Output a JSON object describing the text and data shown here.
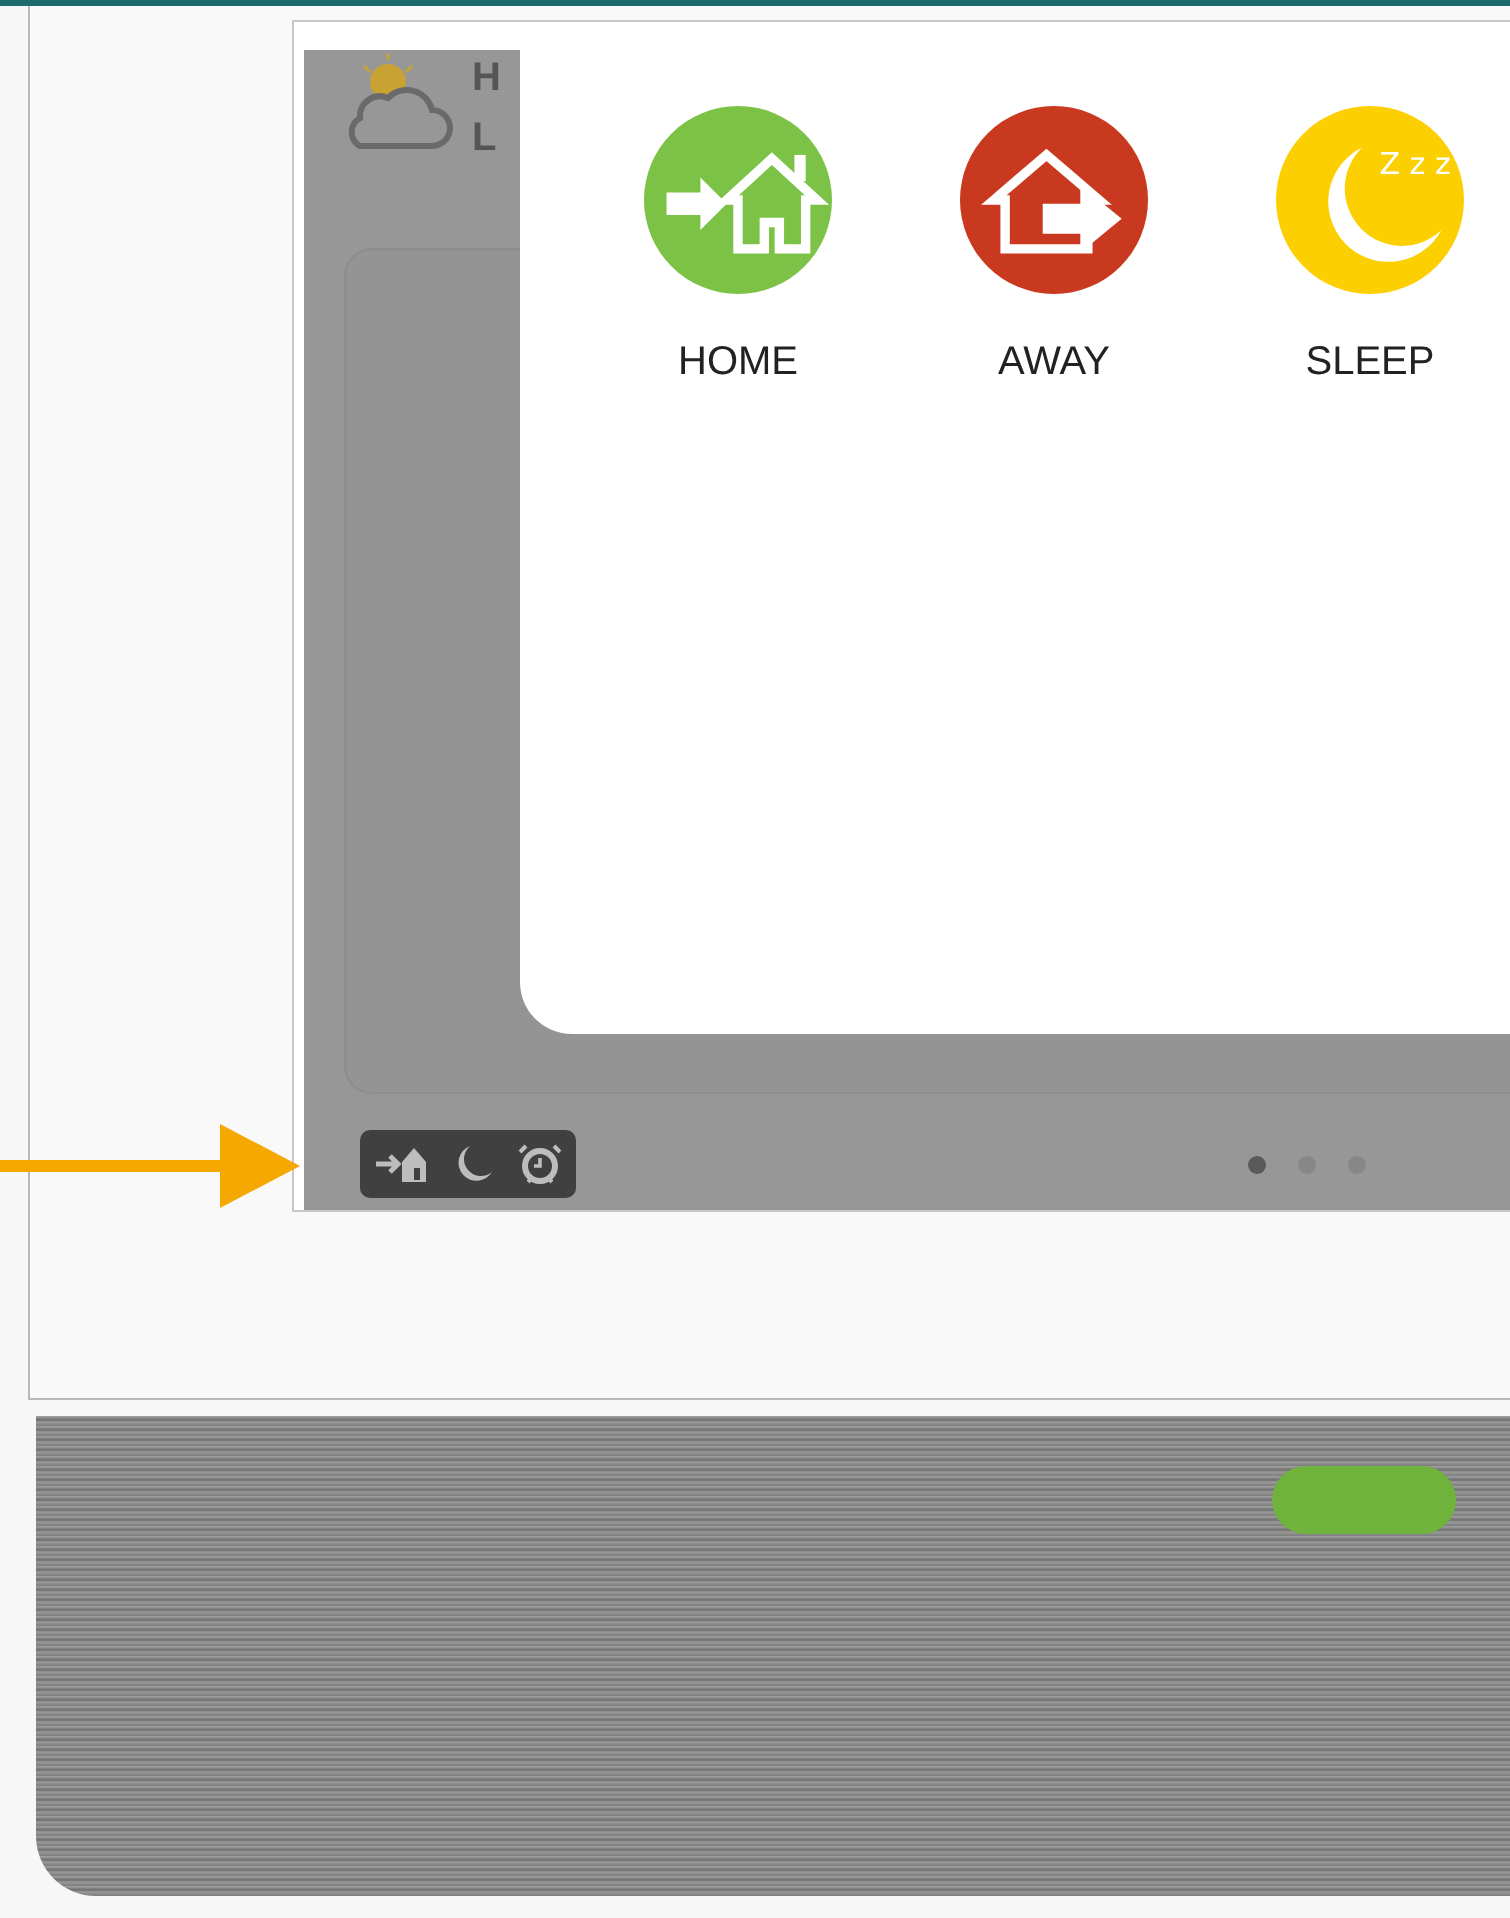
{
  "weather": {
    "high_label": "H",
    "low_label": "L"
  },
  "modes": [
    {
      "kind": "home",
      "label": "HOME",
      "color": "#7bc247"
    },
    {
      "kind": "away",
      "label": "AWAY",
      "color": "#c8391f"
    },
    {
      "kind": "sleep",
      "label": "SLEEP",
      "color": "#fcd000",
      "icon_text": "Z z z"
    }
  ],
  "quick_actions": [
    {
      "kind": "home"
    },
    {
      "kind": "sleep"
    },
    {
      "kind": "alarm"
    }
  ],
  "pages": [
    {
      "selected": true
    },
    {
      "selected": false
    },
    {
      "selected": false
    }
  ]
}
